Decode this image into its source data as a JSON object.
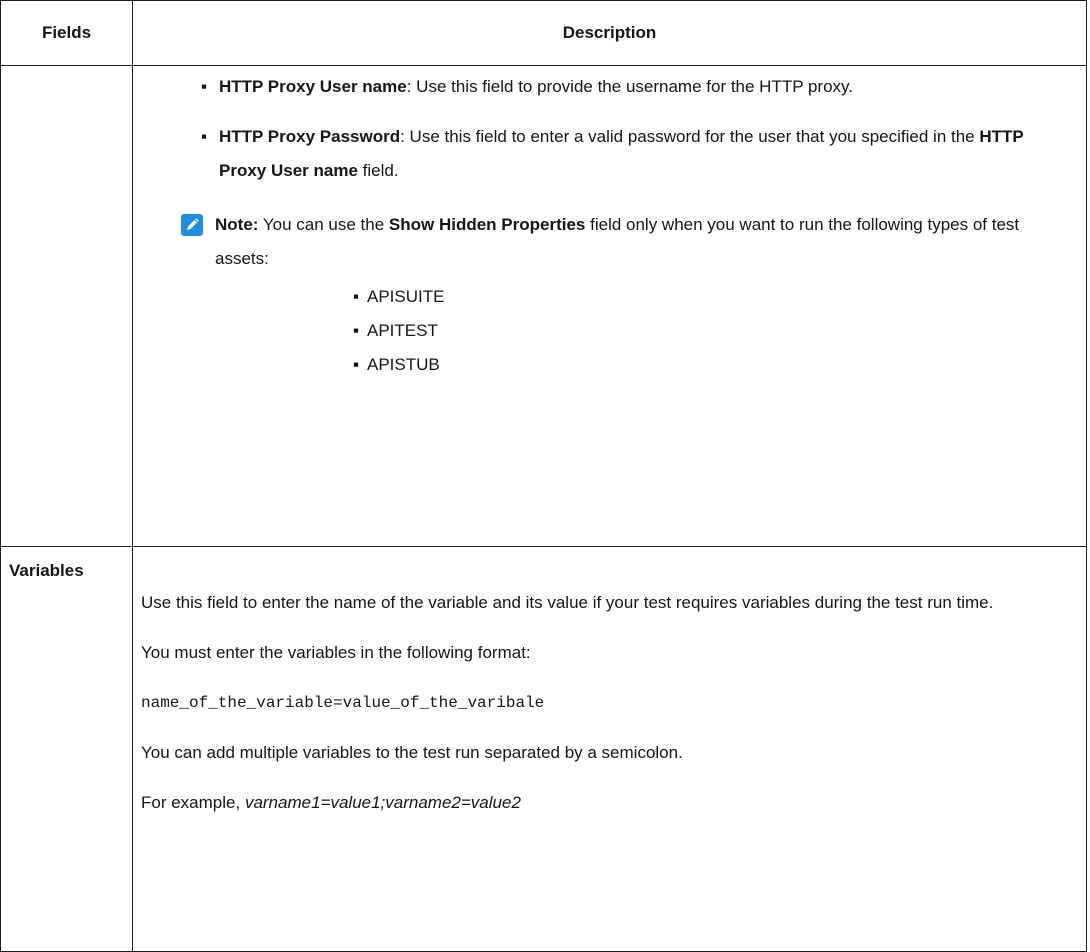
{
  "table": {
    "header_fields": "Fields",
    "header_description": "Description"
  },
  "row_proxy": {
    "bullets": [
      {
        "marker": "▪",
        "term": "HTTP Proxy User name",
        "text": ": Use this field to provide the username for the HTTP proxy."
      },
      {
        "marker": "▪",
        "term": "HTTP Proxy Password",
        "text_before": ": Use this field to enter a valid password for the user that you specified in the ",
        "term2": "HTTP Proxy User name",
        "text_after": " field."
      }
    ],
    "note": {
      "label": "Note:",
      "text_before": " You can use the ",
      "term": "Show Hidden Properties",
      "text_after": " field only when you want to run the following types of test assets:",
      "items": [
        "APISUITE",
        "APITEST",
        "APISTUB"
      ],
      "item_marker": "▪"
    }
  },
  "row_variables": {
    "field": "Variables",
    "p1": "Use this field to enter the name of the variable and its value if your test requires variables during the test run time.",
    "p2": "You must enter the variables in the following format:",
    "p3": "name_of_the_variable=value_of_the_varibale",
    "p4": "You can add multiple variables to the test run separated by a semicolon.",
    "p5_prefix": "For example, ",
    "p5_example": "varname1=value1;varname2=value2"
  },
  "colors": {
    "note_icon": "#1f8de0",
    "border": "#1a1a1a",
    "text": "#161616"
  },
  "icons": {
    "note": "pencil-note-icon"
  }
}
